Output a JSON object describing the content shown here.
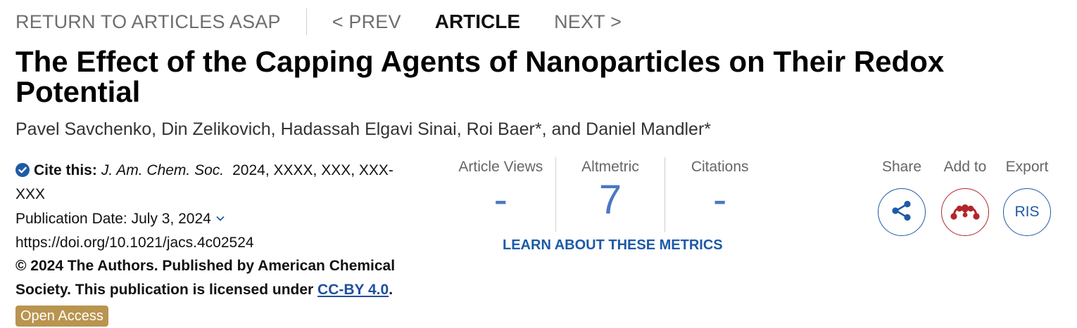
{
  "nav": {
    "return": "RETURN TO ARTICLES ASAP",
    "prev": "< PREV",
    "current": "ARTICLE",
    "next": "NEXT >"
  },
  "article": {
    "title": "The Effect of the Capping Agents of Nanoparticles on Their Redox Potential",
    "authors": "Pavel Savchenko, Din Zelikovich, Hadassah Elgavi Sinai, Roi Baer*, and Daniel Mandler*"
  },
  "citation": {
    "label": "Cite this:",
    "journal": "J. Am. Chem. Soc.",
    "value": "2024, XXXX, XXX, XXX-",
    "value_cont": "XXX",
    "pub_date": "Publication Date: July 3, 2024",
    "doi": "https://doi.org/10.1021/jacs.4c02524",
    "license_line1": "© 2024 The Authors. Published by American Chemical",
    "license_line2": "Society. This publication is licensed under",
    "license_link": "CC-BY 4.0",
    "license_end": ".",
    "open_access": "Open Access"
  },
  "metrics": {
    "views_label": "Article Views",
    "views_value": "-",
    "altmetric_label": "Altmetric",
    "altmetric_value": "7",
    "citations_label": "Citations",
    "citations_value": "-",
    "learn_more": "LEARN ABOUT THESE METRICS"
  },
  "actions": {
    "share_label": "Share",
    "addto_label": "Add to",
    "export_label": "Export",
    "ris": "RIS"
  },
  "icons": {
    "check": "check-circle-icon",
    "chevron": "chevron-down-icon",
    "share": "share-icon",
    "mendeley": "mendeley-icon"
  },
  "colors": {
    "accent_blue": "#1f5aa8",
    "metric_blue": "#4a78c2",
    "open_access_bg": "#b9954f",
    "mendeley_red": "#b3262b"
  }
}
